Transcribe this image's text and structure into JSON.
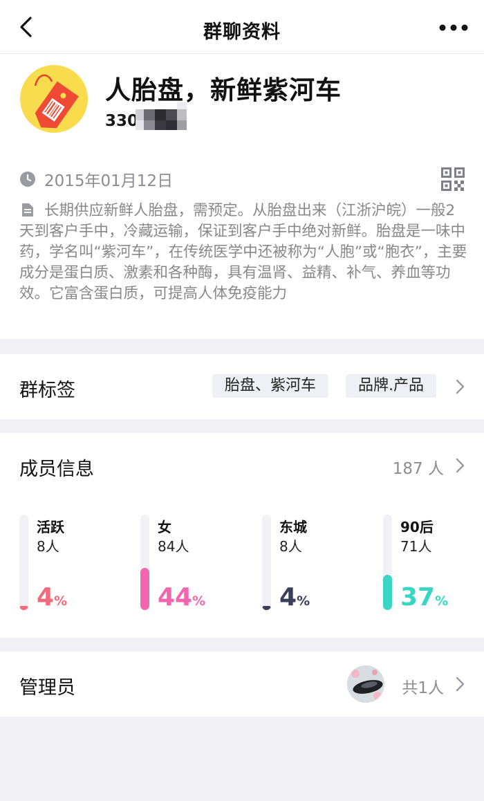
{
  "nav": {
    "title": "群聊资料",
    "back_icon": "chevron-left-icon",
    "more_icon": "more-dots-icon"
  },
  "group": {
    "name": "人胎盘，新鲜紫河车",
    "id_visible": "330",
    "date": "2015年01月12日",
    "description": "长期供应新鲜人胎盘，需预定。从胎盘出来（江浙沪皖）一般2天到客户手中，冷藏运输，保证到客户手中绝对新鲜。胎盘是一味中药，学名叫“紫河车”，在传统医学中还被称为“人胞”或“胞衣”，主要成分是蛋白质、激素和各种酶，具有温肾、益精、补气、养血等功效。它富含蛋白质，可提高人体免疫能力"
  },
  "tags": {
    "label": "群标签",
    "items": [
      "胎盘、紫河车",
      "品牌.产品"
    ]
  },
  "members": {
    "label": "成员信息",
    "count": "187 人",
    "stats": [
      {
        "name": "活跃",
        "count": "8人",
        "percent": "4",
        "unit": "%",
        "fraction": 0.04,
        "color": "#f06a7a"
      },
      {
        "name": "女",
        "count": "84人",
        "percent": "44",
        "unit": "%",
        "fraction": 0.44,
        "color": "#f266b0"
      },
      {
        "name": "东城",
        "count": "8人",
        "percent": "4",
        "unit": "%",
        "fraction": 0.04,
        "color": "#3a3d5c"
      },
      {
        "name": "90后",
        "count": "71人",
        "percent": "37",
        "unit": "%",
        "fraction": 0.37,
        "color": "#3ad6c4"
      }
    ]
  },
  "admin": {
    "label": "管理员",
    "count": "共1人"
  }
}
